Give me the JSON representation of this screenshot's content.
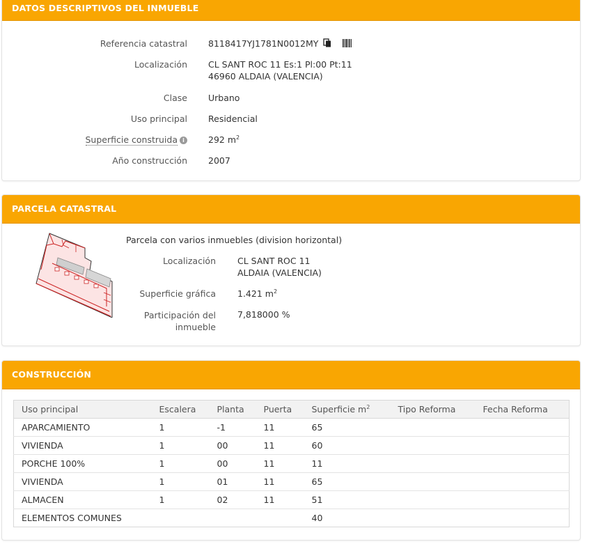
{
  "datos": {
    "header": "DATOS DESCRIPTIVOS DEL INMUEBLE",
    "referencia_label": "Referencia catastral",
    "referencia_value": "8118417YJ1781N0012MY",
    "localizacion_label": "Localización",
    "localizacion_line1": "CL SANT ROC 11 Es:1 Pl:00 Pt:11",
    "localizacion_line2": "46960 ALDAIA (VALENCIA)",
    "clase_label": "Clase",
    "clase_value": "Urbano",
    "uso_label": "Uso principal",
    "uso_value": "Residencial",
    "superficie_label": "Superficie construida",
    "superficie_value": "292 m",
    "superficie_unit_sup": "2",
    "anio_label": "Año construcción",
    "anio_value": "2007"
  },
  "parcela": {
    "header": "PARCELA CATASTRAL",
    "descripcion": "Parcela con varios inmuebles (division horizontal)",
    "localizacion_label": "Localización",
    "localizacion_line1": "CL SANT ROC 11",
    "localizacion_line2": "ALDAIA (VALENCIA)",
    "superficie_label": "Superficie gráfica",
    "superficie_value": "1.421 m",
    "superficie_unit_sup": "2",
    "participacion_label_1": "Participación del",
    "participacion_label_2": "inmueble",
    "participacion_value": "7,818000 %"
  },
  "construccion": {
    "header": "CONSTRUCCIÓN",
    "columns": [
      "Uso principal",
      "Escalera",
      "Planta",
      "Puerta",
      "Superficie m",
      "Tipo Reforma",
      "Fecha Reforma"
    ],
    "superficie_sup": "2",
    "rows": [
      [
        "APARCAMIENTO",
        "1",
        "-1",
        "11",
        "65",
        "",
        ""
      ],
      [
        "VIVIENDA",
        "1",
        "00",
        "11",
        "60",
        "",
        ""
      ],
      [
        "PORCHE 100%",
        "1",
        "00",
        "11",
        "11",
        "",
        ""
      ],
      [
        "VIVIENDA",
        "1",
        "01",
        "11",
        "65",
        "",
        ""
      ],
      [
        "ALMACEN",
        "1",
        "02",
        "11",
        "51",
        "",
        ""
      ],
      [
        "ELEMENTOS COMUNES",
        "",
        "",
        "",
        "40",
        "",
        ""
      ]
    ]
  },
  "icons": {
    "copy": "copy-icon",
    "barcode": "barcode-icon",
    "info": "info-icon",
    "info_glyph": "i"
  },
  "colors": {
    "header_bg": "#f9a602",
    "header_text": "#ffffff"
  }
}
